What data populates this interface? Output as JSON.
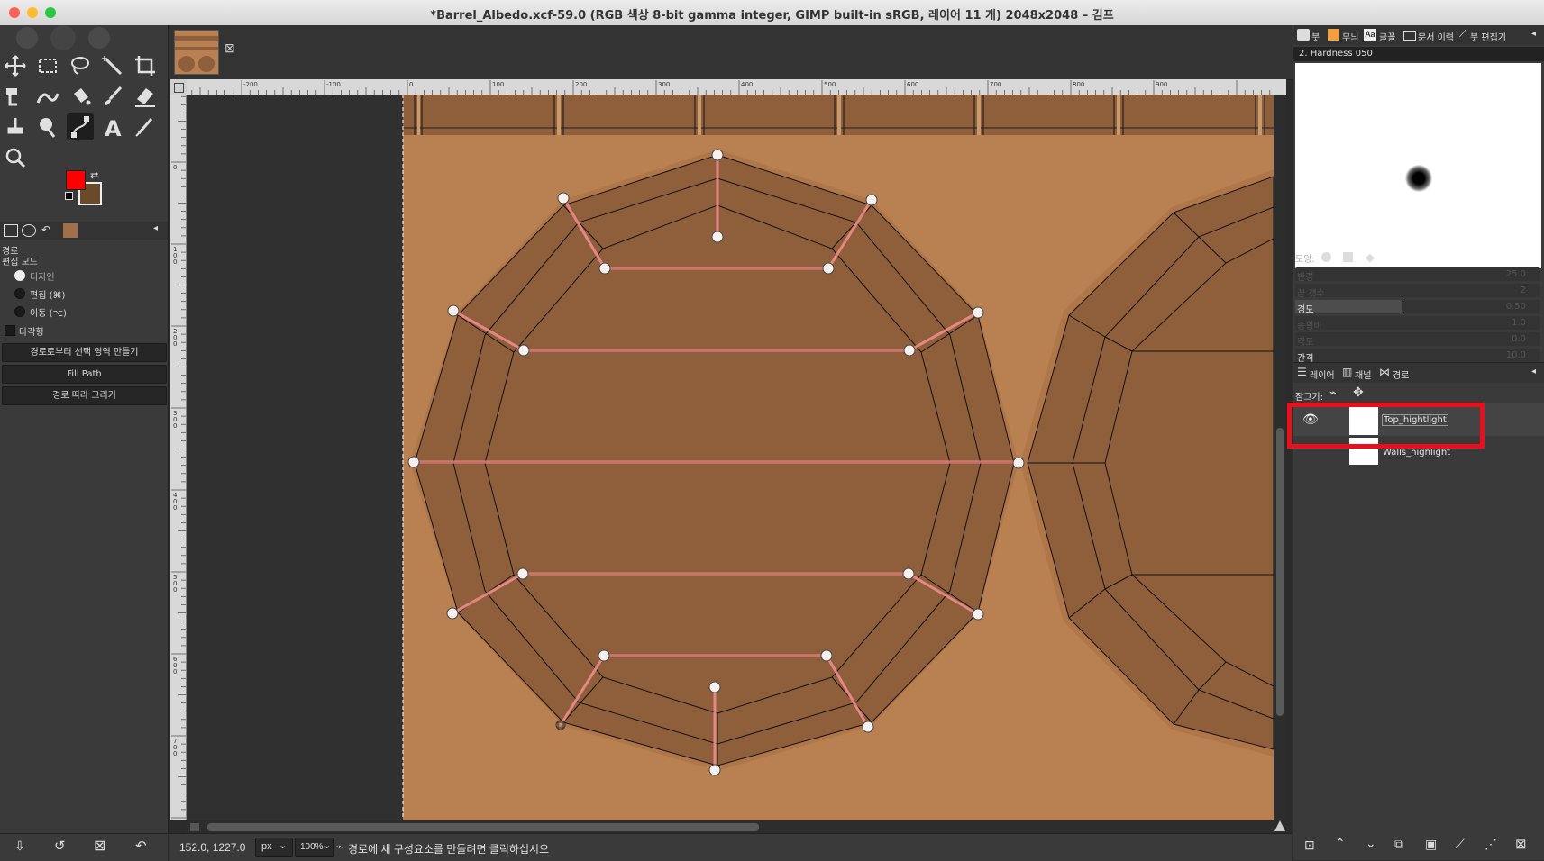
{
  "window": {
    "title": "*Barrel_Albedo.xcf-59.0 (RGB 색상 8-bit gamma integer, GIMP built-in sRGB, 레이어 11 개) 2048x2048 – 김프"
  },
  "tool_options": {
    "section_title": "경로",
    "edit_mode_label": "편집 모드",
    "modes": [
      "디자인",
      "편집 (⌘)",
      "이동 (⌥)"
    ],
    "selected_mode": "디자인",
    "polygon_label": "다각형",
    "buttons": [
      "경로로부터 선택 영역 만들기",
      "Fill Path",
      "경로 따라 그리기"
    ]
  },
  "colors": {
    "foreground": "#ff0000",
    "background": "#6b4a2a",
    "canvas_fill": "#b98052",
    "barrel_top_dark": "#8f5f3c",
    "highlight_box": "#e8101a",
    "path_color": "#f08c8c"
  },
  "ruler": {
    "h_labels": [
      "-200",
      "-100",
      "0",
      "100",
      "200",
      "300",
      "400",
      "500",
      "600",
      "700",
      "800",
      "900"
    ],
    "v_labels": [
      "0",
      "100",
      "200",
      "300",
      "400",
      "500",
      "600",
      "700"
    ]
  },
  "status": {
    "coords": "152.0, 1227.0",
    "unit": "px",
    "zoom": "100%",
    "message": "경로에 새 구성요소를 만들려면 클릭하십시오"
  },
  "brushes_panel": {
    "tabs": [
      "붓",
      "무늬",
      "글꼴",
      "문서 이력",
      "붓 편집기"
    ],
    "brush_name": "2. Hardness 050",
    "shape_label": "모양:",
    "sliders": [
      {
        "label": "반경",
        "value": "25.0"
      },
      {
        "label": "끝 갯수",
        "value": "2"
      },
      {
        "label": "경도",
        "value": "0.50"
      },
      {
        "label": "종횡비",
        "value": "1.0"
      },
      {
        "label": "각도",
        "value": "0.0"
      },
      {
        "label": "간격",
        "value": "10.0"
      }
    ],
    "hardness": 0.5
  },
  "paths_panel": {
    "tabs": [
      "레이어",
      "채널",
      "경로"
    ],
    "lock_label": "잠그기:",
    "paths": [
      {
        "name": "Top_hightlight",
        "visible": true,
        "selected": true
      },
      {
        "name": "Walls_highlight",
        "visible": false,
        "selected": false
      }
    ]
  }
}
